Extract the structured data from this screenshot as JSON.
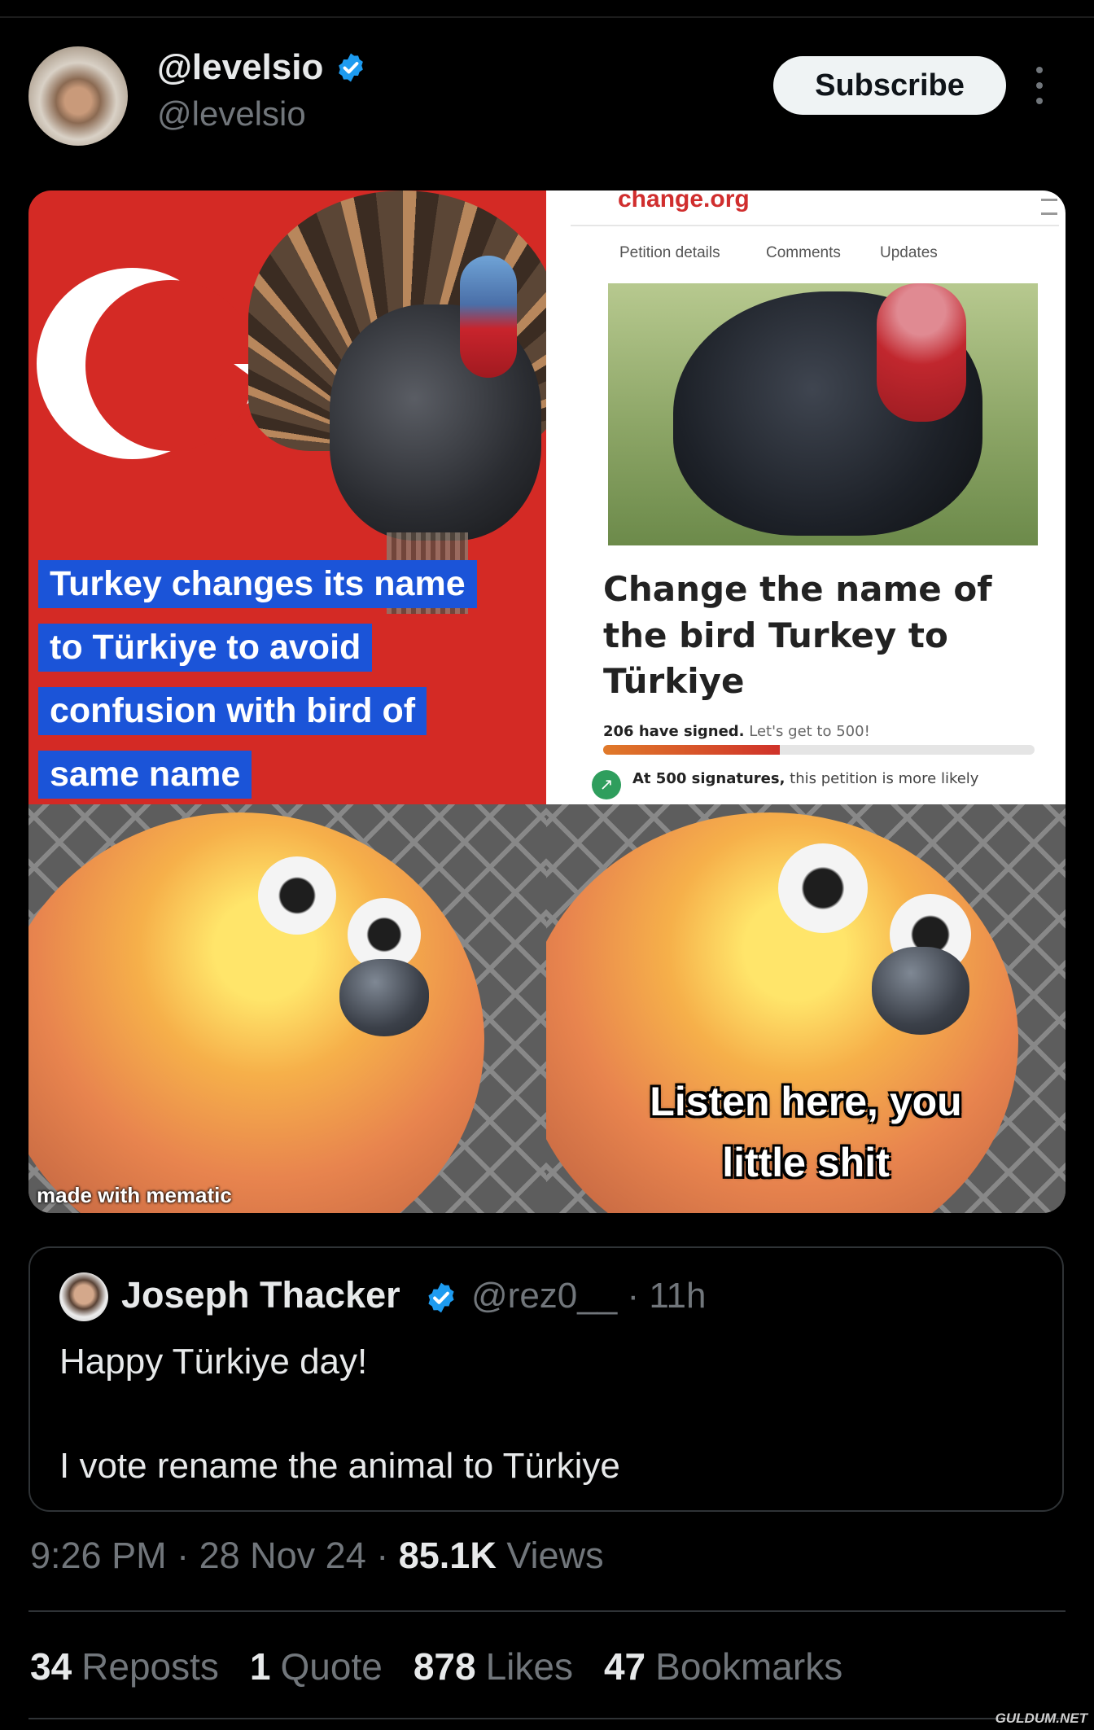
{
  "post": {
    "display_name": "@levelsio",
    "handle": "@levelsio",
    "subscribe_label": "Subscribe",
    "verified_color": "#1d9bf0"
  },
  "media": {
    "top_left_caption": [
      "Turkey changes its name",
      "to Türkiye to avoid",
      "confusion with bird of",
      "same name"
    ],
    "petition": {
      "site": "change.org",
      "tabs": [
        "Petition details",
        "Comments",
        "Updates"
      ],
      "title": "Change the name of the bird Turkey to Türkiye",
      "signed_count": "206 have signed.",
      "signed_cta": "Let's get to 500!",
      "progress_fraction": 0.41,
      "goal_strong": "At 500 signatures,",
      "goal_rest": "this petition is more likely"
    },
    "watermark": "made with mematic",
    "meme_text": [
      "Listen here, you",
      "little shit"
    ]
  },
  "quoted": {
    "name": "Joseph Thacker",
    "handle": "@rez0__",
    "separator": "·",
    "time": "11h",
    "text_line1": "Happy Türkiye day!",
    "text_line2": "I vote rename the animal to Türkiye"
  },
  "meta": {
    "time": "9:26 PM",
    "date": "28 Nov 24",
    "views_count": "85.1K",
    "views_label": "Views"
  },
  "stats": [
    {
      "count": "34",
      "label": "Reposts"
    },
    {
      "count": "1",
      "label": "Quote"
    },
    {
      "count": "878",
      "label": "Likes"
    },
    {
      "count": "47",
      "label": "Bookmarks"
    }
  ],
  "site_watermark": "GULDUM.NET"
}
